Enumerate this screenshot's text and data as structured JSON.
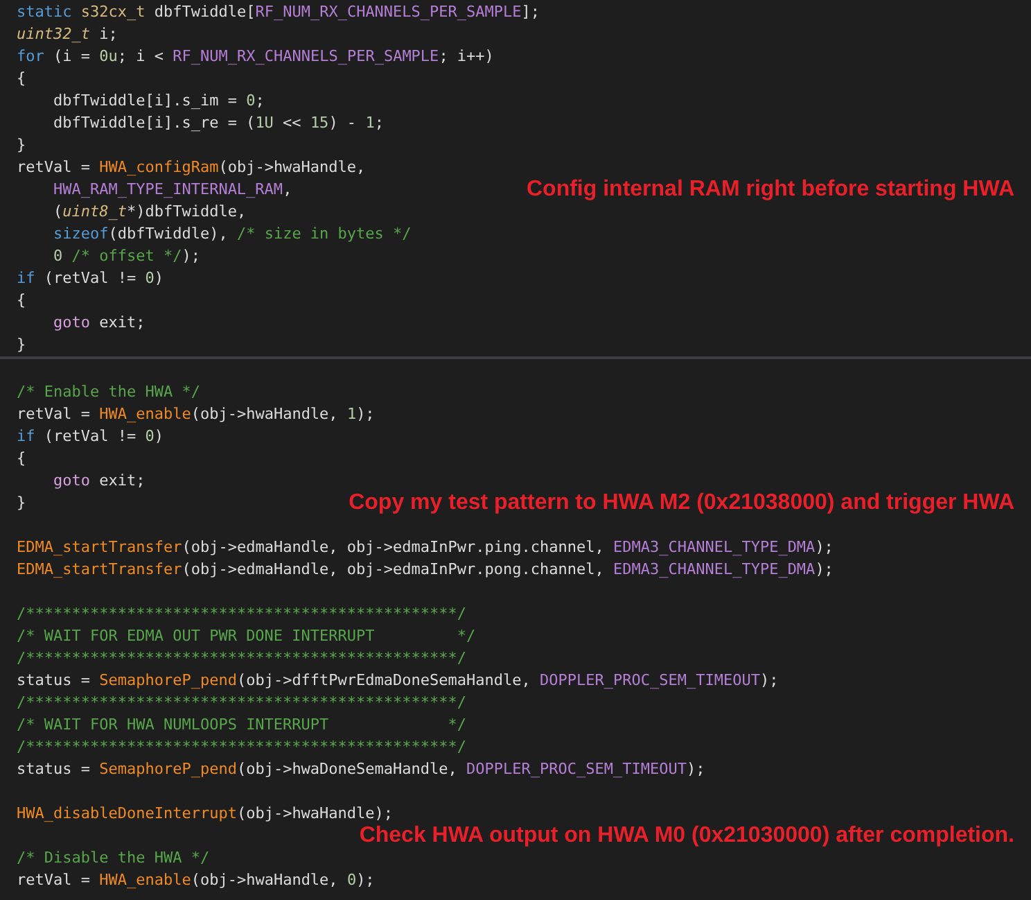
{
  "panels": [
    {
      "lines": [
        {
          "kind": "code",
          "indented": false,
          "tokens": [
            {
              "kind": "keyword",
              "text": "static"
            },
            {
              "kind": "type",
              "text": " s32cx_t"
            },
            {
              "kind": "plain",
              "text": " dbfTwiddle["
            },
            {
              "kind": "macro",
              "text": "RF_NUM_RX_CHANNELS_PER_SAMPLE"
            },
            {
              "kind": "plain",
              "text": "];"
            }
          ]
        },
        {
          "kind": "code",
          "indented": false,
          "tokens": [
            {
              "kind": "italictype",
              "text": "uint32_t"
            },
            {
              "kind": "plain",
              "text": " i;"
            }
          ]
        },
        {
          "kind": "code",
          "indented": false,
          "tokens": [
            {
              "kind": "keyword",
              "text": "for"
            },
            {
              "kind": "plain",
              "text": " (i = "
            },
            {
              "kind": "number",
              "text": "0u"
            },
            {
              "kind": "plain",
              "text": "; i < "
            },
            {
              "kind": "macro",
              "text": "RF_NUM_RX_CHANNELS_PER_SAMPLE"
            },
            {
              "kind": "plain",
              "text": "; i++)"
            }
          ]
        },
        {
          "kind": "code",
          "indented": false,
          "tokens": [
            {
              "kind": "plain",
              "text": "{"
            }
          ]
        },
        {
          "kind": "code",
          "indented": true,
          "tokens": [
            {
              "kind": "plain",
              "text": "dbfTwiddle[i].s_im = "
            },
            {
              "kind": "number",
              "text": "0"
            },
            {
              "kind": "plain",
              "text": ";"
            }
          ]
        },
        {
          "kind": "code",
          "indented": true,
          "tokens": [
            {
              "kind": "plain",
              "text": "dbfTwiddle[i].s_re = ("
            },
            {
              "kind": "number",
              "text": "1U"
            },
            {
              "kind": "plain",
              "text": " << "
            },
            {
              "kind": "number",
              "text": "15"
            },
            {
              "kind": "plain",
              "text": ") - "
            },
            {
              "kind": "number",
              "text": "1"
            },
            {
              "kind": "plain",
              "text": ";"
            }
          ]
        },
        {
          "kind": "code",
          "indented": false,
          "tokens": [
            {
              "kind": "plain",
              "text": "}"
            }
          ]
        },
        {
          "kind": "code",
          "indented": false,
          "tokens": [
            {
              "kind": "plain",
              "text": "retVal = "
            },
            {
              "kind": "function",
              "text": "HWA_configRam"
            },
            {
              "kind": "plain",
              "text": "(obj->hwaHandle,"
            }
          ]
        },
        {
          "kind": "code",
          "indented": true,
          "tokens": [
            {
              "kind": "macro",
              "text": "HWA_RAM_TYPE_INTERNAL_RAM"
            },
            {
              "kind": "plain",
              "text": ","
            }
          ],
          "note": "Config internal RAM right before starting HWA"
        },
        {
          "kind": "code",
          "indented": true,
          "tokens": [
            {
              "kind": "plain",
              "text": "("
            },
            {
              "kind": "italictype",
              "text": "uint8_t"
            },
            {
              "kind": "plain",
              "text": "*)dbfTwiddle,"
            }
          ]
        },
        {
          "kind": "code",
          "indented": true,
          "tokens": [
            {
              "kind": "keyword",
              "text": "sizeof"
            },
            {
              "kind": "plain",
              "text": "(dbfTwiddle), "
            },
            {
              "kind": "comment",
              "text": "/* size in bytes */"
            }
          ]
        },
        {
          "kind": "code",
          "indented": true,
          "tokens": [
            {
              "kind": "number",
              "text": "0"
            },
            {
              "kind": "comment",
              "text": " /* offset */"
            },
            {
              "kind": "plain",
              "text": ");"
            }
          ]
        },
        {
          "kind": "code",
          "indented": false,
          "tokens": [
            {
              "kind": "keyword",
              "text": "if"
            },
            {
              "kind": "plain",
              "text": " (retVal != "
            },
            {
              "kind": "number",
              "text": "0"
            },
            {
              "kind": "plain",
              "text": ")"
            }
          ]
        },
        {
          "kind": "code",
          "indented": false,
          "tokens": [
            {
              "kind": "plain",
              "text": "{"
            }
          ]
        },
        {
          "kind": "code",
          "indented": true,
          "tokens": [
            {
              "kind": "control",
              "text": "goto"
            },
            {
              "kind": "plain",
              "text": " exit;"
            }
          ]
        },
        {
          "kind": "code",
          "indented": false,
          "tokens": [
            {
              "kind": "plain",
              "text": "}"
            }
          ]
        }
      ]
    },
    {
      "lines": [
        {
          "kind": "blank"
        },
        {
          "kind": "code",
          "indented": false,
          "tokens": [
            {
              "kind": "comment",
              "text": "/* Enable the HWA */"
            }
          ]
        },
        {
          "kind": "code",
          "indented": false,
          "tokens": [
            {
              "kind": "plain",
              "text": "retVal = "
            },
            {
              "kind": "function",
              "text": "HWA_enable"
            },
            {
              "kind": "plain",
              "text": "(obj->hwaHandle, "
            },
            {
              "kind": "number",
              "text": "1"
            },
            {
              "kind": "plain",
              "text": ");"
            }
          ]
        },
        {
          "kind": "code",
          "indented": false,
          "tokens": [
            {
              "kind": "keyword",
              "text": "if"
            },
            {
              "kind": "plain",
              "text": " (retVal != "
            },
            {
              "kind": "number",
              "text": "0"
            },
            {
              "kind": "plain",
              "text": ")"
            }
          ]
        },
        {
          "kind": "code",
          "indented": false,
          "tokens": [
            {
              "kind": "plain",
              "text": "{"
            }
          ]
        },
        {
          "kind": "code",
          "indented": true,
          "tokens": [
            {
              "kind": "control",
              "text": "goto"
            },
            {
              "kind": "plain",
              "text": " exit;"
            }
          ]
        },
        {
          "kind": "code",
          "indented": false,
          "tokens": [
            {
              "kind": "plain",
              "text": "}"
            }
          ],
          "note": "Copy my test pattern to HWA M2 (0x21038000) and trigger HWA"
        },
        {
          "kind": "blank"
        },
        {
          "kind": "code",
          "indented": false,
          "tokens": [
            {
              "kind": "function",
              "text": "EDMA_startTransfer"
            },
            {
              "kind": "plain",
              "text": "(obj->edmaHandle, obj->edmaInPwr.ping.channel, "
            },
            {
              "kind": "macro",
              "text": "EDMA3_CHANNEL_TYPE_DMA"
            },
            {
              "kind": "plain",
              "text": ");"
            }
          ]
        },
        {
          "kind": "code",
          "indented": false,
          "tokens": [
            {
              "kind": "function",
              "text": "EDMA_startTransfer"
            },
            {
              "kind": "plain",
              "text": "(obj->edmaHandle, obj->edmaInPwr.pong.channel, "
            },
            {
              "kind": "macro",
              "text": "EDMA3_CHANNEL_TYPE_DMA"
            },
            {
              "kind": "plain",
              "text": ");"
            }
          ]
        },
        {
          "kind": "blank"
        },
        {
          "kind": "code",
          "indented": false,
          "tokens": [
            {
              "kind": "comment",
              "text": "/***********************************************/"
            }
          ]
        },
        {
          "kind": "code",
          "indented": false,
          "tokens": [
            {
              "kind": "comment",
              "text": "/* WAIT FOR EDMA OUT PWR DONE INTERRUPT         */"
            }
          ]
        },
        {
          "kind": "code",
          "indented": false,
          "tokens": [
            {
              "kind": "comment",
              "text": "/***********************************************/"
            }
          ]
        },
        {
          "kind": "code",
          "indented": false,
          "tokens": [
            {
              "kind": "plain",
              "text": "status = "
            },
            {
              "kind": "function",
              "text": "SemaphoreP_pend"
            },
            {
              "kind": "plain",
              "text": "(obj->dfftPwrEdmaDoneSemaHandle, "
            },
            {
              "kind": "macro",
              "text": "DOPPLER_PROC_SEM_TIMEOUT"
            },
            {
              "kind": "plain",
              "text": ");"
            }
          ]
        },
        {
          "kind": "code",
          "indented": false,
          "tokens": [
            {
              "kind": "comment",
              "text": "/***********************************************/"
            }
          ]
        },
        {
          "kind": "code",
          "indented": false,
          "tokens": [
            {
              "kind": "comment",
              "text": "/* WAIT FOR HWA NUMLOOPS INTERRUPT             */"
            }
          ]
        },
        {
          "kind": "code",
          "indented": false,
          "tokens": [
            {
              "kind": "comment",
              "text": "/***********************************************/"
            }
          ]
        },
        {
          "kind": "code",
          "indented": false,
          "tokens": [
            {
              "kind": "plain",
              "text": "status = "
            },
            {
              "kind": "function",
              "text": "SemaphoreP_pend"
            },
            {
              "kind": "plain",
              "text": "(obj->hwaDoneSemaHandle, "
            },
            {
              "kind": "macro",
              "text": "DOPPLER_PROC_SEM_TIMEOUT"
            },
            {
              "kind": "plain",
              "text": ");"
            }
          ]
        },
        {
          "kind": "blank"
        },
        {
          "kind": "code",
          "indented": false,
          "tokens": [
            {
              "kind": "function",
              "text": "HWA_disableDoneInterrupt"
            },
            {
              "kind": "plain",
              "text": "(obj->hwaHandle);"
            }
          ]
        },
        {
          "kind": "blank",
          "note": "Check HWA output on HWA M0 (0x21030000) after completion."
        },
        {
          "kind": "code",
          "indented": false,
          "tokens": [
            {
              "kind": "comment",
              "text": "/* Disable the HWA */"
            }
          ]
        },
        {
          "kind": "code",
          "indented": false,
          "tokens": [
            {
              "kind": "plain",
              "text": "retVal = "
            },
            {
              "kind": "function",
              "text": "HWA_enable"
            },
            {
              "kind": "plain",
              "text": "(obj->hwaHandle, "
            },
            {
              "kind": "number",
              "text": "0"
            },
            {
              "kind": "plain",
              "text": ");"
            }
          ]
        }
      ]
    }
  ]
}
